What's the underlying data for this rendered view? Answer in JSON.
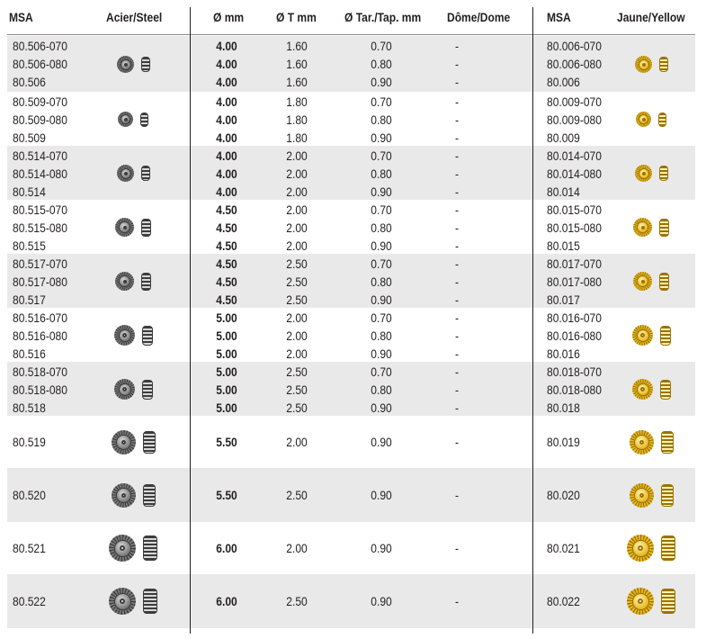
{
  "headers": {
    "msa": "MSA",
    "steel": "Acier/Steel",
    "dia": "Ø mm",
    "t": "Ø T mm",
    "tar": "Ø Tar./Tap. mm",
    "dome": "Dôme/Dome",
    "msa2": "MSA",
    "yellow": "Jaune/Yellow"
  },
  "colors": {
    "shade": "#e9e9e9",
    "steel": "#7a7a7a",
    "gold": "#e8b820"
  },
  "groups": [
    {
      "rows": [
        {
          "msa": "80.506-070",
          "dia": "4.00",
          "t": "1.60",
          "tar": "0.70",
          "dome": "-",
          "msa2": "80.006-070"
        },
        {
          "msa": "80.506-080",
          "dia": "4.00",
          "t": "1.60",
          "tar": "0.80",
          "dome": "-",
          "msa2": "80.006-080"
        },
        {
          "msa": "80.506",
          "dia": "4.00",
          "t": "1.60",
          "tar": "0.90",
          "dome": "-",
          "msa2": "80.006"
        }
      ]
    },
    {
      "rows": [
        {
          "msa": "80.509-070",
          "dia": "4.00",
          "t": "1.80",
          "tar": "0.70",
          "dome": "-",
          "msa2": "80.009-070"
        },
        {
          "msa": "80.509-080",
          "dia": "4.00",
          "t": "1.80",
          "tar": "0.80",
          "dome": "-",
          "msa2": "80.009-080"
        },
        {
          "msa": "80.509",
          "dia": "4.00",
          "t": "1.80",
          "tar": "0.90",
          "dome": "-",
          "msa2": "80.009"
        }
      ]
    },
    {
      "rows": [
        {
          "msa": "80.514-070",
          "dia": "4.00",
          "t": "2.00",
          "tar": "0.70",
          "dome": "-",
          "msa2": "80.014-070"
        },
        {
          "msa": "80.514-080",
          "dia": "4.00",
          "t": "2.00",
          "tar": "0.80",
          "dome": "-",
          "msa2": "80.014-080"
        },
        {
          "msa": "80.514",
          "dia": "4.00",
          "t": "2.00",
          "tar": "0.90",
          "dome": "-",
          "msa2": "80.014"
        }
      ]
    },
    {
      "rows": [
        {
          "msa": "80.515-070",
          "dia": "4.50",
          "t": "2.00",
          "tar": "0.70",
          "dome": "-",
          "msa2": "80.015-070"
        },
        {
          "msa": "80.515-080",
          "dia": "4.50",
          "t": "2.00",
          "tar": "0.80",
          "dome": "-",
          "msa2": "80.015-080"
        },
        {
          "msa": "80.515",
          "dia": "4.50",
          "t": "2.00",
          "tar": "0.90",
          "dome": "-",
          "msa2": "80.015"
        }
      ]
    },
    {
      "rows": [
        {
          "msa": "80.517-070",
          "dia": "4.50",
          "t": "2.50",
          "tar": "0.70",
          "dome": "-",
          "msa2": "80.017-070"
        },
        {
          "msa": "80.517-080",
          "dia": "4.50",
          "t": "2.50",
          "tar": "0.80",
          "dome": "-",
          "msa2": "80.017-080"
        },
        {
          "msa": "80.517",
          "dia": "4.50",
          "t": "2.50",
          "tar": "0.90",
          "dome": "-",
          "msa2": "80.017"
        }
      ]
    },
    {
      "rows": [
        {
          "msa": "80.516-070",
          "dia": "5.00",
          "t": "2.00",
          "tar": "0.70",
          "dome": "-",
          "msa2": "80.016-070"
        },
        {
          "msa": "80.516-080",
          "dia": "5.00",
          "t": "2.00",
          "tar": "0.80",
          "dome": "-",
          "msa2": "80.016-080"
        },
        {
          "msa": "80.516",
          "dia": "5.00",
          "t": "2.00",
          "tar": "0.90",
          "dome": "-",
          "msa2": "80.016"
        }
      ]
    },
    {
      "rows": [
        {
          "msa": "80.518-070",
          "dia": "5.00",
          "t": "2.50",
          "tar": "0.70",
          "dome": "-",
          "msa2": "80.018-070"
        },
        {
          "msa": "80.518-080",
          "dia": "5.00",
          "t": "2.50",
          "tar": "0.80",
          "dome": "-",
          "msa2": "80.018-080"
        },
        {
          "msa": "80.518",
          "dia": "5.00",
          "t": "2.50",
          "tar": "0.90",
          "dome": "-",
          "msa2": "80.018"
        }
      ]
    },
    {
      "rows": [
        {
          "msa": "80.519",
          "dia": "5.50",
          "t": "2.00",
          "tar": "0.90",
          "dome": "-",
          "msa2": "80.019"
        }
      ]
    },
    {
      "rows": [
        {
          "msa": "80.520",
          "dia": "5.50",
          "t": "2.50",
          "tar": "0.90",
          "dome": "-",
          "msa2": "80.020"
        }
      ]
    },
    {
      "rows": [
        {
          "msa": "80.521",
          "dia": "6.00",
          "t": "2.00",
          "tar": "0.90",
          "dome": "-",
          "msa2": "80.021"
        }
      ]
    },
    {
      "rows": [
        {
          "msa": "80.522",
          "dia": "6.00",
          "t": "2.50",
          "tar": "0.90",
          "dome": "-",
          "msa2": "80.022"
        }
      ]
    }
  ]
}
